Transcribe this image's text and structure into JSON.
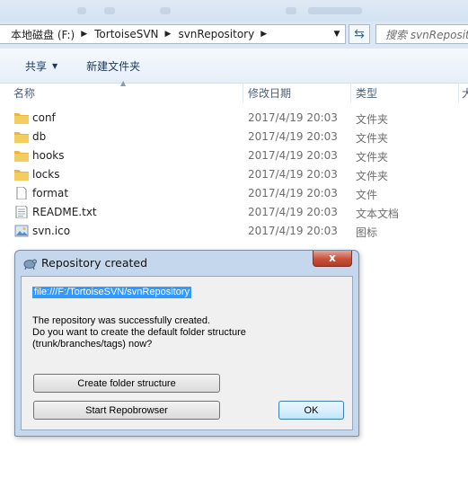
{
  "address": {
    "crumbs": [
      "本地磁盘 (F:)",
      "TortoiseSVN",
      "svnRepository"
    ],
    "search_placeholder": "搜索 svnReposit"
  },
  "toolbar": {
    "share_label": "共享",
    "new_folder_label": "新建文件夹"
  },
  "columns": {
    "name": "名称",
    "date": "修改日期",
    "type": "类型",
    "size": "大"
  },
  "files": [
    {
      "name": "conf",
      "date": "2017/4/19 20:03",
      "type": "文件夹",
      "icon": "folder-icon"
    },
    {
      "name": "db",
      "date": "2017/4/19 20:03",
      "type": "文件夹",
      "icon": "folder-icon"
    },
    {
      "name": "hooks",
      "date": "2017/4/19 20:03",
      "type": "文件夹",
      "icon": "folder-icon"
    },
    {
      "name": "locks",
      "date": "2017/4/19 20:03",
      "type": "文件夹",
      "icon": "folder-icon"
    },
    {
      "name": "format",
      "date": "2017/4/19 20:03",
      "type": "文件",
      "icon": "file-icon"
    },
    {
      "name": "README.txt",
      "date": "2017/4/19 20:03",
      "type": "文本文档",
      "icon": "text-file-icon"
    },
    {
      "name": "svn.ico",
      "date": "2017/4/19 20:03",
      "type": "图标",
      "icon": "image-file-icon"
    }
  ],
  "dialog": {
    "title": "Repository created",
    "close_label": "x",
    "url": "file:///F:/TortoiseSVN/svnRepository",
    "message_line1": "The repository was successfully created.",
    "message_line2": "Do you want to create the default folder structure",
    "message_line3": "(trunk/branches/tags) now?",
    "create_button": "Create folder structure",
    "repobrowser_button": "Start Repobrowser",
    "ok_button": "OK"
  },
  "colors": {
    "folder": "#e8b640",
    "selection": "#3399ff",
    "close_button": "#c7503a"
  }
}
